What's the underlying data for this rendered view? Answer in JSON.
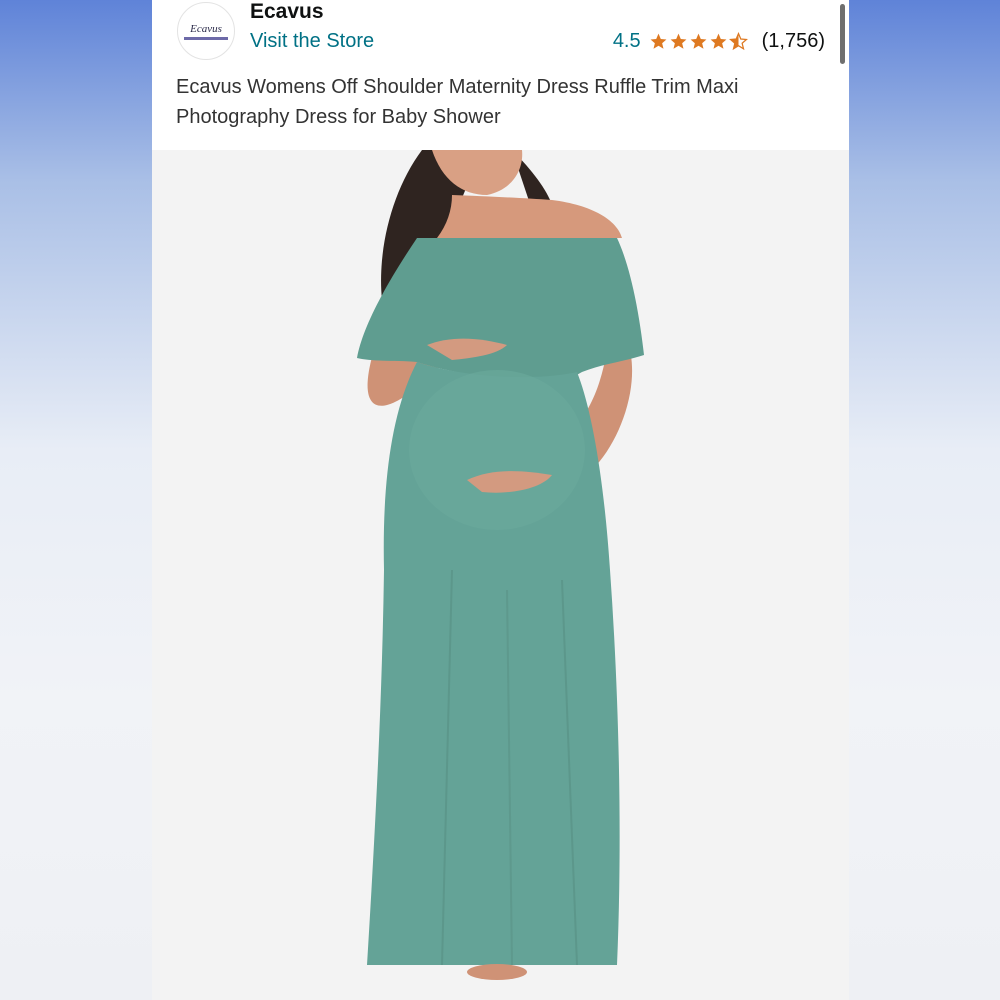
{
  "store": {
    "logo_text": "Ecavus",
    "name": "Ecavus",
    "visit_link": "Visit the Store"
  },
  "rating": {
    "value": "4.5",
    "stars": 4.5,
    "count": "(1,756)"
  },
  "product": {
    "title": "Ecavus Womens Off Shoulder Maternity Dress Ruffle Trim Maxi Photography Dress for Baby Shower",
    "dress_color": "#64a397"
  },
  "colors": {
    "link": "#007185",
    "star": "#de7921"
  }
}
